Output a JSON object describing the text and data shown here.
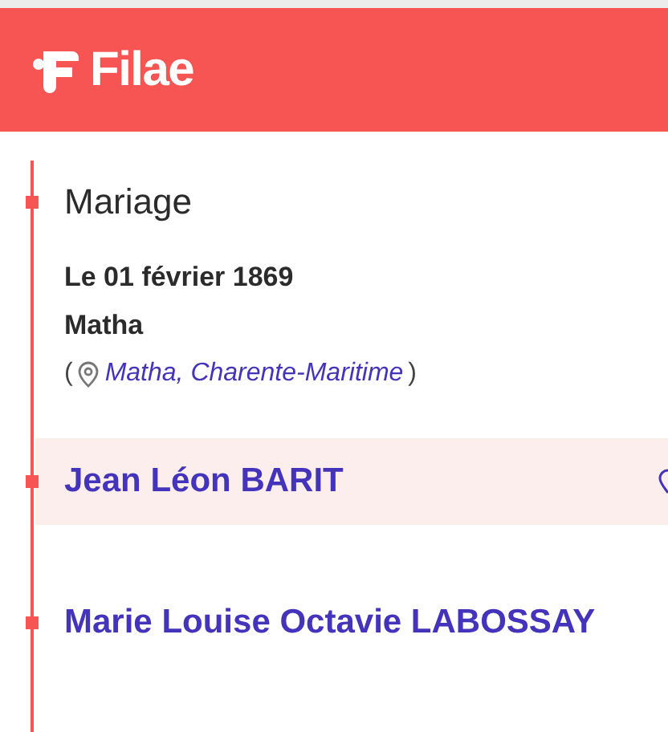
{
  "header": {
    "logo": "Filae"
  },
  "event": {
    "title": "Mariage",
    "date": "Le 01 février 1869",
    "place": "Matha",
    "location_open": "(",
    "location_link": "Matha, Charente-Maritime",
    "location_close": ")"
  },
  "persons": [
    {
      "name": "Jean Léon BARIT",
      "highlighted": true
    },
    {
      "name": "Marie Louise Octavie LABOSSAY",
      "highlighted": false
    }
  ]
}
